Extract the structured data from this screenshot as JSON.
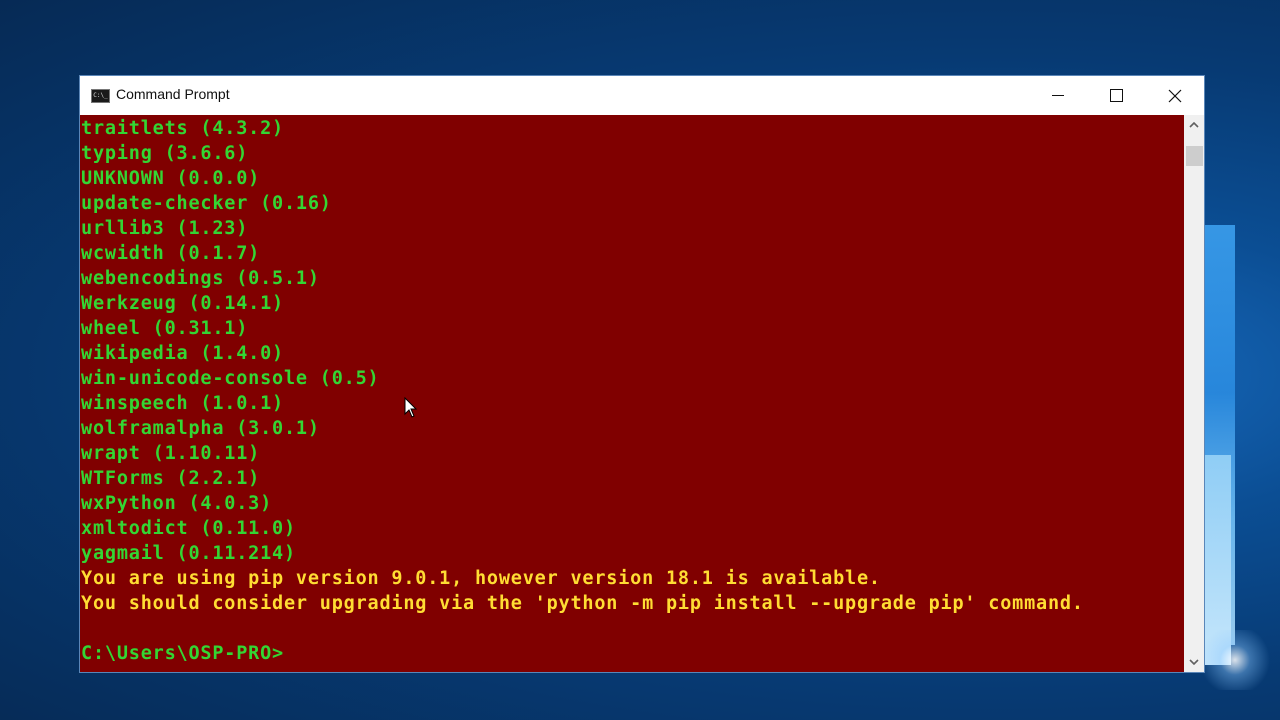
{
  "window": {
    "title": "Command Prompt",
    "app_icon_label": "C:\\_",
    "controls": {
      "minimize": "minimize",
      "maximize": "maximize",
      "close": "close"
    }
  },
  "console": {
    "colors": {
      "background": "#800000",
      "package_text": "#33d633",
      "warning_text": "#ffdd33"
    },
    "packages": [
      "traitlets (4.3.2)",
      "typing (3.6.6)",
      "UNKNOWN (0.0.0)",
      "update-checker (0.16)",
      "urllib3 (1.23)",
      "wcwidth (0.1.7)",
      "webencodings (0.5.1)",
      "Werkzeug (0.14.1)",
      "wheel (0.31.1)",
      "wikipedia (1.4.0)",
      "win-unicode-console (0.5)",
      "winspeech (1.0.1)",
      "wolframalpha (3.0.1)",
      "wrapt (1.10.11)",
      "WTForms (2.2.1)",
      "wxPython (4.0.3)",
      "xmltodict (0.11.0)",
      "yagmail (0.11.214)"
    ],
    "warnings": [
      "You are using pip version 9.0.1, however version 18.1 is available.",
      "You should consider upgrading via the 'python -m pip install --upgrade pip' command."
    ],
    "prompt": "C:\\Users\\OSP-PRO>"
  },
  "scrollbar": {
    "up_arrow": "^",
    "down_arrow": "v"
  }
}
